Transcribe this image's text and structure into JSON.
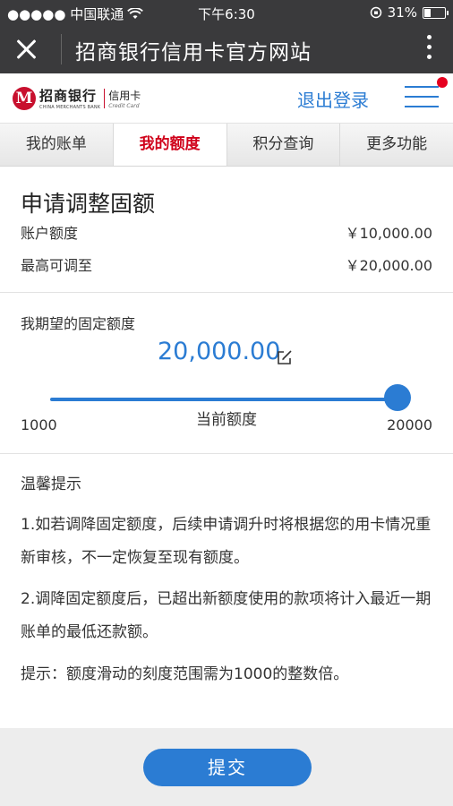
{
  "status_bar": {
    "carrier": "●●●●● 中国联通",
    "time": "下午6:30",
    "battery_text": "31%",
    "battery_level": 0.31
  },
  "title_bar": {
    "title": "招商银行信用卡官方网站"
  },
  "brand": {
    "logo_cn": "招商银行",
    "logo_en": "CHINA MERCHANTS BANK",
    "card_cn": "信用卡",
    "card_en": "Credit Card",
    "logout_label": "退出登录",
    "brand_color": "#c8102e"
  },
  "tabs": [
    {
      "label": "我的账单",
      "active": false
    },
    {
      "label": "我的额度",
      "active": true
    },
    {
      "label": "积分查询",
      "active": false
    },
    {
      "label": "更多功能",
      "active": false
    }
  ],
  "adjust": {
    "heading": "申请调整固额",
    "account_limit_label": "账户额度",
    "account_limit_value": "￥10,000.00",
    "max_adjust_label": "最高可调至",
    "max_adjust_value": "￥20,000.00"
  },
  "desired": {
    "label": "我期望的固定额度",
    "amount": "20,000.00",
    "slider_min": "1000",
    "slider_max": "20000",
    "slider_value": 20000,
    "current_label": "当前额度"
  },
  "tips": {
    "title": "温馨提示",
    "tip1": "1.如若调降固定额度，后续申请调升时将根据您的用卡情况重新审核，不一定恢复至现有额度。",
    "tip2": "2.调降固定额度后，已超出新额度使用的款项将计入最近一期账单的最低还款额。",
    "tip3": "提示：额度滑动的刻度范围需为1000的整数倍。"
  },
  "footer": {
    "submit_label": "提交"
  },
  "colors": {
    "accent": "#2b7cd3",
    "active_tab": "#d0021b",
    "notification": "#e6001f"
  }
}
